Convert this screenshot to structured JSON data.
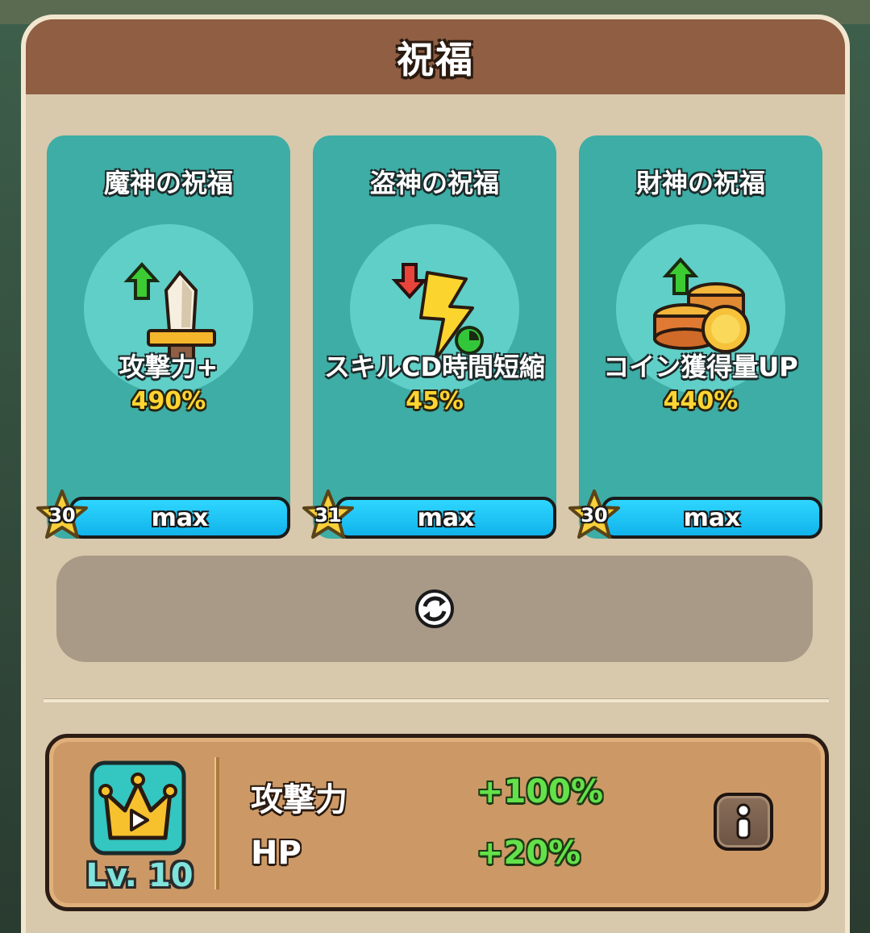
{
  "panel": {
    "title": "祝福"
  },
  "cards": [
    {
      "title": "魔神の祝福",
      "effect": "攻撃力+",
      "value": "490%",
      "star_level": "30",
      "bar_label": "max",
      "icon": "sword-icon",
      "arrow": "up"
    },
    {
      "title": "盗神の祝福",
      "effect": "スキルCD時間短縮",
      "value": "45%",
      "star_level": "31",
      "bar_label": "max",
      "icon": "lightning-icon",
      "arrow": "down"
    },
    {
      "title": "財神の祝福",
      "effect": "コイン獲得量UP",
      "value": "440%",
      "star_level": "30",
      "bar_label": "max",
      "icon": "coins-icon",
      "arrow": "up"
    }
  ],
  "refresh": {
    "icon": "refresh-icon"
  },
  "bonus": {
    "level": "Lv. 10",
    "icon": "crown-icon",
    "stats": [
      {
        "label": "攻撃力",
        "value": "+100%"
      },
      {
        "label": "HP",
        "value": "+20%"
      }
    ],
    "info_icon": "info-icon"
  },
  "colors": {
    "header": "#8f5e43",
    "panel": "#d8c8ac",
    "card": "#3dada5",
    "bar": "#11b3ea",
    "value_yellow": "#ffd531",
    "stat_green": "#63e14a"
  }
}
